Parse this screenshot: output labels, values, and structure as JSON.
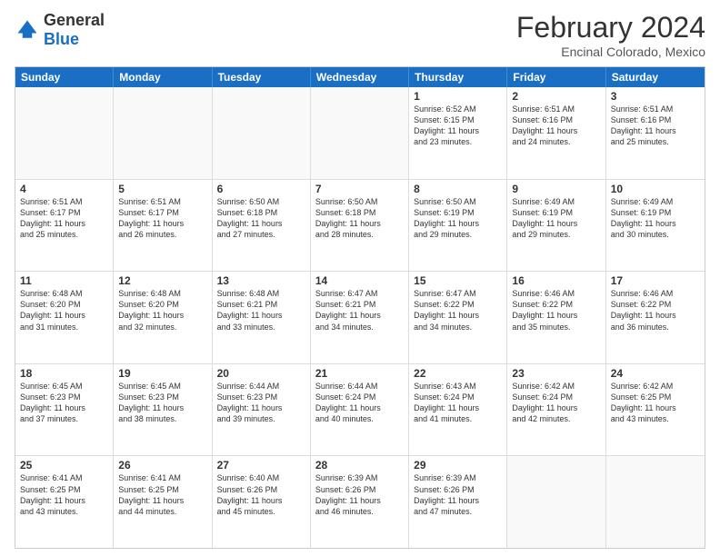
{
  "header": {
    "logo_general": "General",
    "logo_blue": "Blue",
    "main_title": "February 2024",
    "subtitle": "Encinal Colorado, Mexico"
  },
  "weekdays": [
    "Sunday",
    "Monday",
    "Tuesday",
    "Wednesday",
    "Thursday",
    "Friday",
    "Saturday"
  ],
  "rows": [
    [
      {
        "day": "",
        "empty": true
      },
      {
        "day": "",
        "empty": true
      },
      {
        "day": "",
        "empty": true
      },
      {
        "day": "",
        "empty": true
      },
      {
        "day": "1",
        "lines": [
          "Sunrise: 6:52 AM",
          "Sunset: 6:15 PM",
          "Daylight: 11 hours",
          "and 23 minutes."
        ]
      },
      {
        "day": "2",
        "lines": [
          "Sunrise: 6:51 AM",
          "Sunset: 6:16 PM",
          "Daylight: 11 hours",
          "and 24 minutes."
        ]
      },
      {
        "day": "3",
        "lines": [
          "Sunrise: 6:51 AM",
          "Sunset: 6:16 PM",
          "Daylight: 11 hours",
          "and 25 minutes."
        ]
      }
    ],
    [
      {
        "day": "4",
        "lines": [
          "Sunrise: 6:51 AM",
          "Sunset: 6:17 PM",
          "Daylight: 11 hours",
          "and 25 minutes."
        ]
      },
      {
        "day": "5",
        "lines": [
          "Sunrise: 6:51 AM",
          "Sunset: 6:17 PM",
          "Daylight: 11 hours",
          "and 26 minutes."
        ]
      },
      {
        "day": "6",
        "lines": [
          "Sunrise: 6:50 AM",
          "Sunset: 6:18 PM",
          "Daylight: 11 hours",
          "and 27 minutes."
        ]
      },
      {
        "day": "7",
        "lines": [
          "Sunrise: 6:50 AM",
          "Sunset: 6:18 PM",
          "Daylight: 11 hours",
          "and 28 minutes."
        ]
      },
      {
        "day": "8",
        "lines": [
          "Sunrise: 6:50 AM",
          "Sunset: 6:19 PM",
          "Daylight: 11 hours",
          "and 29 minutes."
        ]
      },
      {
        "day": "9",
        "lines": [
          "Sunrise: 6:49 AM",
          "Sunset: 6:19 PM",
          "Daylight: 11 hours",
          "and 29 minutes."
        ]
      },
      {
        "day": "10",
        "lines": [
          "Sunrise: 6:49 AM",
          "Sunset: 6:19 PM",
          "Daylight: 11 hours",
          "and 30 minutes."
        ]
      }
    ],
    [
      {
        "day": "11",
        "lines": [
          "Sunrise: 6:48 AM",
          "Sunset: 6:20 PM",
          "Daylight: 11 hours",
          "and 31 minutes."
        ]
      },
      {
        "day": "12",
        "lines": [
          "Sunrise: 6:48 AM",
          "Sunset: 6:20 PM",
          "Daylight: 11 hours",
          "and 32 minutes."
        ]
      },
      {
        "day": "13",
        "lines": [
          "Sunrise: 6:48 AM",
          "Sunset: 6:21 PM",
          "Daylight: 11 hours",
          "and 33 minutes."
        ]
      },
      {
        "day": "14",
        "lines": [
          "Sunrise: 6:47 AM",
          "Sunset: 6:21 PM",
          "Daylight: 11 hours",
          "and 34 minutes."
        ]
      },
      {
        "day": "15",
        "lines": [
          "Sunrise: 6:47 AM",
          "Sunset: 6:22 PM",
          "Daylight: 11 hours",
          "and 34 minutes."
        ]
      },
      {
        "day": "16",
        "lines": [
          "Sunrise: 6:46 AM",
          "Sunset: 6:22 PM",
          "Daylight: 11 hours",
          "and 35 minutes."
        ]
      },
      {
        "day": "17",
        "lines": [
          "Sunrise: 6:46 AM",
          "Sunset: 6:22 PM",
          "Daylight: 11 hours",
          "and 36 minutes."
        ]
      }
    ],
    [
      {
        "day": "18",
        "lines": [
          "Sunrise: 6:45 AM",
          "Sunset: 6:23 PM",
          "Daylight: 11 hours",
          "and 37 minutes."
        ]
      },
      {
        "day": "19",
        "lines": [
          "Sunrise: 6:45 AM",
          "Sunset: 6:23 PM",
          "Daylight: 11 hours",
          "and 38 minutes."
        ]
      },
      {
        "day": "20",
        "lines": [
          "Sunrise: 6:44 AM",
          "Sunset: 6:23 PM",
          "Daylight: 11 hours",
          "and 39 minutes."
        ]
      },
      {
        "day": "21",
        "lines": [
          "Sunrise: 6:44 AM",
          "Sunset: 6:24 PM",
          "Daylight: 11 hours",
          "and 40 minutes."
        ]
      },
      {
        "day": "22",
        "lines": [
          "Sunrise: 6:43 AM",
          "Sunset: 6:24 PM",
          "Daylight: 11 hours",
          "and 41 minutes."
        ]
      },
      {
        "day": "23",
        "lines": [
          "Sunrise: 6:42 AM",
          "Sunset: 6:24 PM",
          "Daylight: 11 hours",
          "and 42 minutes."
        ]
      },
      {
        "day": "24",
        "lines": [
          "Sunrise: 6:42 AM",
          "Sunset: 6:25 PM",
          "Daylight: 11 hours",
          "and 43 minutes."
        ]
      }
    ],
    [
      {
        "day": "25",
        "lines": [
          "Sunrise: 6:41 AM",
          "Sunset: 6:25 PM",
          "Daylight: 11 hours",
          "and 43 minutes."
        ]
      },
      {
        "day": "26",
        "lines": [
          "Sunrise: 6:41 AM",
          "Sunset: 6:25 PM",
          "Daylight: 11 hours",
          "and 44 minutes."
        ]
      },
      {
        "day": "27",
        "lines": [
          "Sunrise: 6:40 AM",
          "Sunset: 6:26 PM",
          "Daylight: 11 hours",
          "and 45 minutes."
        ]
      },
      {
        "day": "28",
        "lines": [
          "Sunrise: 6:39 AM",
          "Sunset: 6:26 PM",
          "Daylight: 11 hours",
          "and 46 minutes."
        ]
      },
      {
        "day": "29",
        "lines": [
          "Sunrise: 6:39 AM",
          "Sunset: 6:26 PM",
          "Daylight: 11 hours",
          "and 47 minutes."
        ]
      },
      {
        "day": "",
        "empty": true
      },
      {
        "day": "",
        "empty": true
      }
    ]
  ]
}
